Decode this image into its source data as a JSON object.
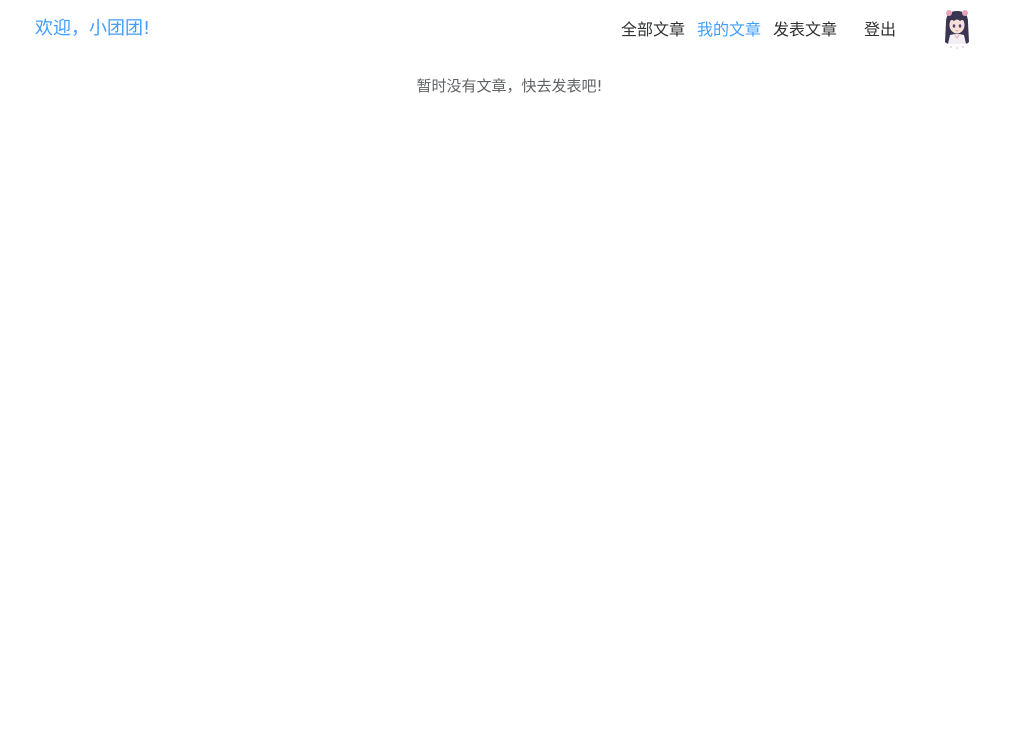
{
  "header": {
    "welcome": "欢迎，小团团!",
    "nav": [
      {
        "label": "全部文章",
        "active": false
      },
      {
        "label": "我的文章",
        "active": true
      },
      {
        "label": "发表文章",
        "active": false
      },
      {
        "label": "登出",
        "active": false
      }
    ],
    "avatar_icon": "anime-girl-avatar-icon"
  },
  "main": {
    "empty_message": "暂时没有文章，快去发表吧!"
  },
  "colors": {
    "accent": "#409eff",
    "text": "#303133",
    "muted": "#606266",
    "background": "#ffffff"
  }
}
